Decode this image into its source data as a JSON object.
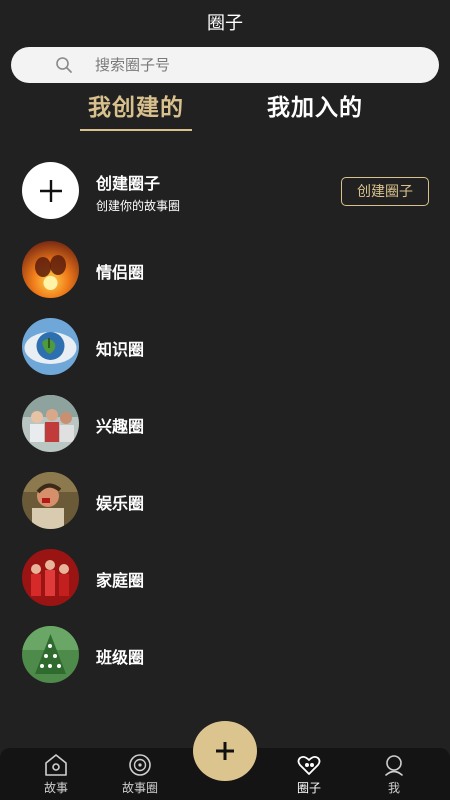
{
  "header": {
    "title": "圈子"
  },
  "search": {
    "placeholder": "搜索圈子号",
    "icon": "search-icon"
  },
  "tabs": [
    {
      "label": "我创建的",
      "active": true
    },
    {
      "label": "我加入的",
      "active": false
    }
  ],
  "create_row": {
    "title": "创建圈子",
    "subtitle": "创建你的故事圈",
    "button_label": "创建圈子",
    "icon": "plus-icon"
  },
  "circles": [
    {
      "label": "情侣圈",
      "thumb": "couple-sunset"
    },
    {
      "label": "知识圈",
      "thumb": "globe-earth"
    },
    {
      "label": "兴趣圈",
      "thumb": "friends-group"
    },
    {
      "label": "娱乐圈",
      "thumb": "celebrity-portrait"
    },
    {
      "label": "家庭圈",
      "thumb": "family-red"
    },
    {
      "label": "班级圈",
      "thumb": "class-green"
    }
  ],
  "bottom_nav": [
    {
      "label": "故事",
      "icon": "home-icon"
    },
    {
      "label": "故事圈",
      "icon": "vinyl-icon"
    },
    {
      "label": "圈子",
      "icon": "heart-people-icon",
      "active": true
    },
    {
      "label": "我",
      "icon": "person-icon"
    }
  ],
  "fab": {
    "icon": "plus-icon"
  },
  "colors": {
    "background": "#212121",
    "accent": "#d9c18d",
    "search_bg": "#f3f3f3",
    "nav_bg": "#141414"
  }
}
